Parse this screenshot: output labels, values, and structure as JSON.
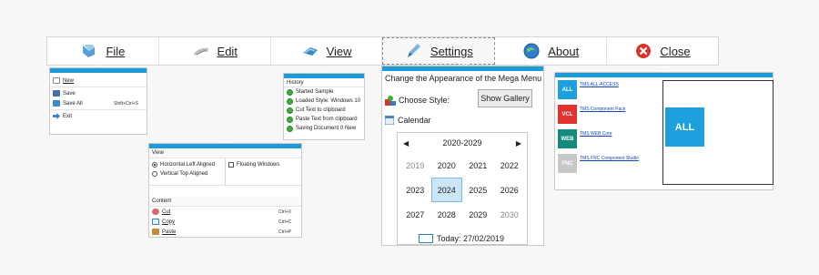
{
  "menubar": {
    "items": [
      {
        "label": "File",
        "icon": "file-icon"
      },
      {
        "label": "Edit",
        "icon": "edit-icon"
      },
      {
        "label": "View",
        "icon": "view-icon"
      },
      {
        "label": "Settings",
        "icon": "settings-icon"
      },
      {
        "label": "About",
        "icon": "about-icon"
      },
      {
        "label": "Close",
        "icon": "close-icon"
      }
    ],
    "active": "Settings"
  },
  "file_panel": {
    "items": [
      {
        "label": "New",
        "shortcut": ""
      },
      {
        "label": "Save",
        "shortcut": ""
      },
      {
        "label": "Save All",
        "shortcut": "Shift+Ctrl+S"
      },
      {
        "label": "Exit",
        "shortcut": ""
      }
    ]
  },
  "history_panel": {
    "title": "History",
    "items": [
      "Started Sample",
      "Loaded Style: Windows 10",
      "Cut Text to clipboard",
      "Paste Text from clipboard",
      "Saving Document 0 New"
    ]
  },
  "view_panel": {
    "view_title": "View",
    "options": [
      {
        "label": "Horizontal Left Aligned",
        "selected": true
      },
      {
        "label": "Vertical Top Aligned",
        "selected": false
      }
    ],
    "checkbox_label": "Floating Windows",
    "content_title": "Content",
    "content_items": [
      {
        "label": "Cut",
        "shortcut": "Ctrl+X"
      },
      {
        "label": "Copy",
        "shortcut": "Ctrl+C"
      },
      {
        "label": "Paste",
        "shortcut": "Ctrl+P"
      }
    ]
  },
  "settings_panel": {
    "title": "Change the Appearance of the Mega Menu",
    "choose_style": "Choose Style:",
    "show_gallery": "Show Gallery",
    "calendar_label": "Calendar",
    "decade": "2020-2029",
    "years": [
      {
        "y": "2019",
        "dim": true
      },
      {
        "y": "2020",
        "dim": false
      },
      {
        "y": "2021",
        "dim": false
      },
      {
        "y": "2022",
        "dim": false
      },
      {
        "y": "2023",
        "dim": false
      },
      {
        "y": "2024",
        "dim": false,
        "selected": true
      },
      {
        "y": "2025",
        "dim": false
      },
      {
        "y": "2026",
        "dim": false
      },
      {
        "y": "2027",
        "dim": false
      },
      {
        "y": "2028",
        "dim": false
      },
      {
        "y": "2029",
        "dim": false
      },
      {
        "y": "2030",
        "dim": true
      }
    ],
    "today": "Today: 27/02/2019"
  },
  "products_panel": {
    "items": [
      {
        "tile": "ALL",
        "label": "TMS ALL-ACCESS",
        "color": "#1ea0de"
      },
      {
        "tile": "VCL",
        "label": "TMS Component Pack",
        "color": "#e0332f"
      },
      {
        "tile": "WEB",
        "label": "TMS WEB Core",
        "color": "#138a7c"
      },
      {
        "tile": "FNC",
        "label": "TMS FNC Component Studio",
        "color": "#c8c8c8"
      }
    ],
    "preview_tile": "ALL"
  },
  "colors": {
    "accent": "#1e9ad8",
    "success": "#3cae3a"
  }
}
